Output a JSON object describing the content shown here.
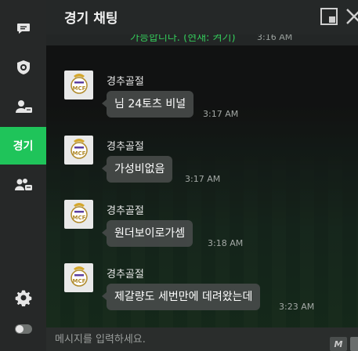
{
  "header": {
    "title": "경기 채팅"
  },
  "sidebar": {
    "items": [
      {
        "name": "chat",
        "icon": "chat-bubble-icon"
      },
      {
        "name": "club",
        "icon": "shield-emblem-icon"
      },
      {
        "name": "profile",
        "icon": "user-chat-icon"
      },
      {
        "name": "match",
        "label": "경기",
        "active": true
      },
      {
        "name": "group",
        "icon": "group-chat-icon"
      }
    ],
    "bottom": [
      {
        "name": "settings",
        "icon": "gear-icon"
      },
      {
        "name": "toggle",
        "icon": "toggle-icon"
      }
    ],
    "accent_color": "#1fc45a"
  },
  "system": {
    "text": "가능합니다. (현재: 켜기)",
    "time": "3:16 AM"
  },
  "messages": [
    {
      "sender": "경추골절",
      "text": "님 24토츠 비널",
      "time": "3:17 AM"
    },
    {
      "sender": "경추골절",
      "text": "가성비없음",
      "time": "3:17 AM"
    },
    {
      "sender": "경추골절",
      "text": "원더보이로가셈",
      "time": "3:18 AM"
    },
    {
      "sender": "경추골절",
      "text": "제갈량도 세번만에 데려왔는데",
      "time": "3:23 AM"
    }
  ],
  "input": {
    "placeholder": "메시지를 입력하세요.",
    "macro_label": "M"
  }
}
